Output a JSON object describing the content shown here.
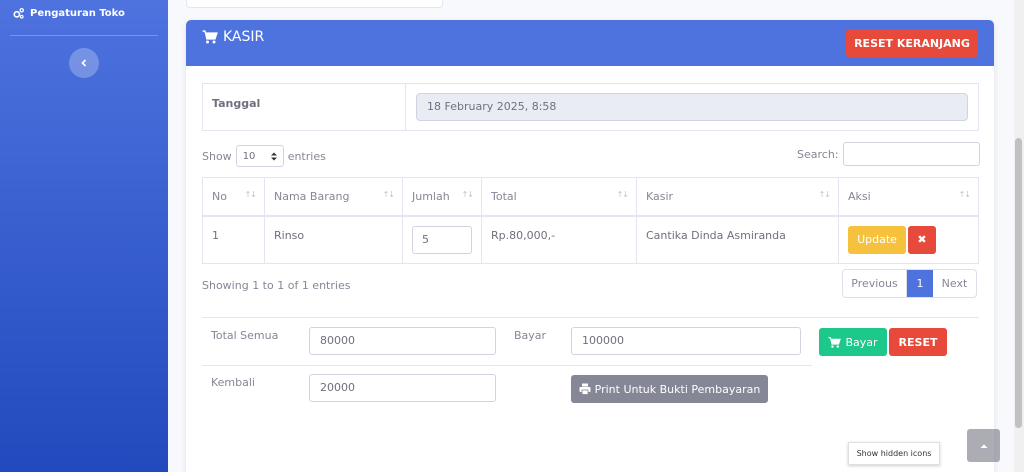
{
  "sidebar": {
    "settings_label": "Pengaturan Toko"
  },
  "card": {
    "title": "KASIR",
    "reset_cart_label": "RESET KERANJANG",
    "date_label": "Tanggal",
    "date_value": "18 February 2025, 8:58"
  },
  "datatable": {
    "show_label": "Show",
    "entries_value": "10",
    "entries_label": "entries",
    "search_label": "Search:",
    "columns": [
      "No",
      "Nama Barang",
      "Jumlah",
      "Total",
      "Kasir",
      "Aksi"
    ],
    "rows": [
      {
        "no": "1",
        "nama_barang": "Rinso",
        "jumlah": "5",
        "total": "Rp.80,000,-",
        "kasir": "Cantika Dinda Asmiranda",
        "update_label": "Update",
        "delete_label": "✖"
      }
    ],
    "info": "Showing 1 to 1 of 1 entries",
    "pagination": {
      "previous": "Previous",
      "current": "1",
      "next": "Next"
    }
  },
  "payment": {
    "total_label": "Total Semua",
    "total_value": "80000",
    "bayar_label": "Bayar",
    "bayar_value": "100000",
    "bayar_button": "Bayar",
    "reset_button": "RESET",
    "kembali_label": "Kembali",
    "kembali_value": "20000",
    "print_button": "Print Untuk Bukti Pembayaran"
  },
  "taskbar": {
    "tooltip": "Show hidden icons"
  }
}
